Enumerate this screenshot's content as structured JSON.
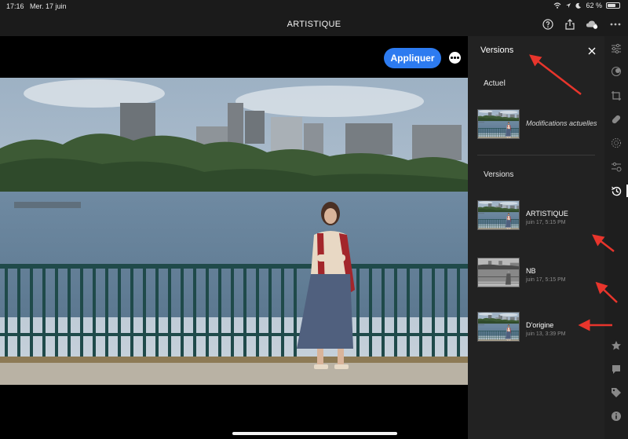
{
  "status_bar": {
    "time": "17:16",
    "date": "Mer. 17 juin",
    "battery": "62 %",
    "battery_level": 0.62
  },
  "title_bar": {
    "title": "ARTISTIQUE",
    "icons": [
      "help-icon",
      "share-icon",
      "cloud-sync-icon",
      "more-icon"
    ]
  },
  "canvas": {
    "apply_label": "Appliquer"
  },
  "versions_panel": {
    "header": "Versions",
    "current_section": "Actuel",
    "current_item": "Modifications actuelles",
    "versions_section": "Versions",
    "items": [
      {
        "name": "ARTISTIQUE",
        "date": "juin 17, 5:15 PM"
      },
      {
        "name": "NB",
        "date": "juin 17, 5:15 PM"
      },
      {
        "name": "D'origine",
        "date": "juin 13, 3:39 PM"
      }
    ]
  },
  "right_toolbar": {
    "icons": [
      "light-sliders-icon",
      "color-icon",
      "crop-icon",
      "healing-icon",
      "selective-icon",
      "presets-icon",
      "versions-icon",
      "star-icon",
      "comment-icon",
      "tag-icon",
      "info-icon"
    ],
    "active": "versions-icon"
  },
  "colors": {
    "accent": "#2d7bf0",
    "panel": "#222222",
    "annotation_arrow": "#e8352c"
  }
}
